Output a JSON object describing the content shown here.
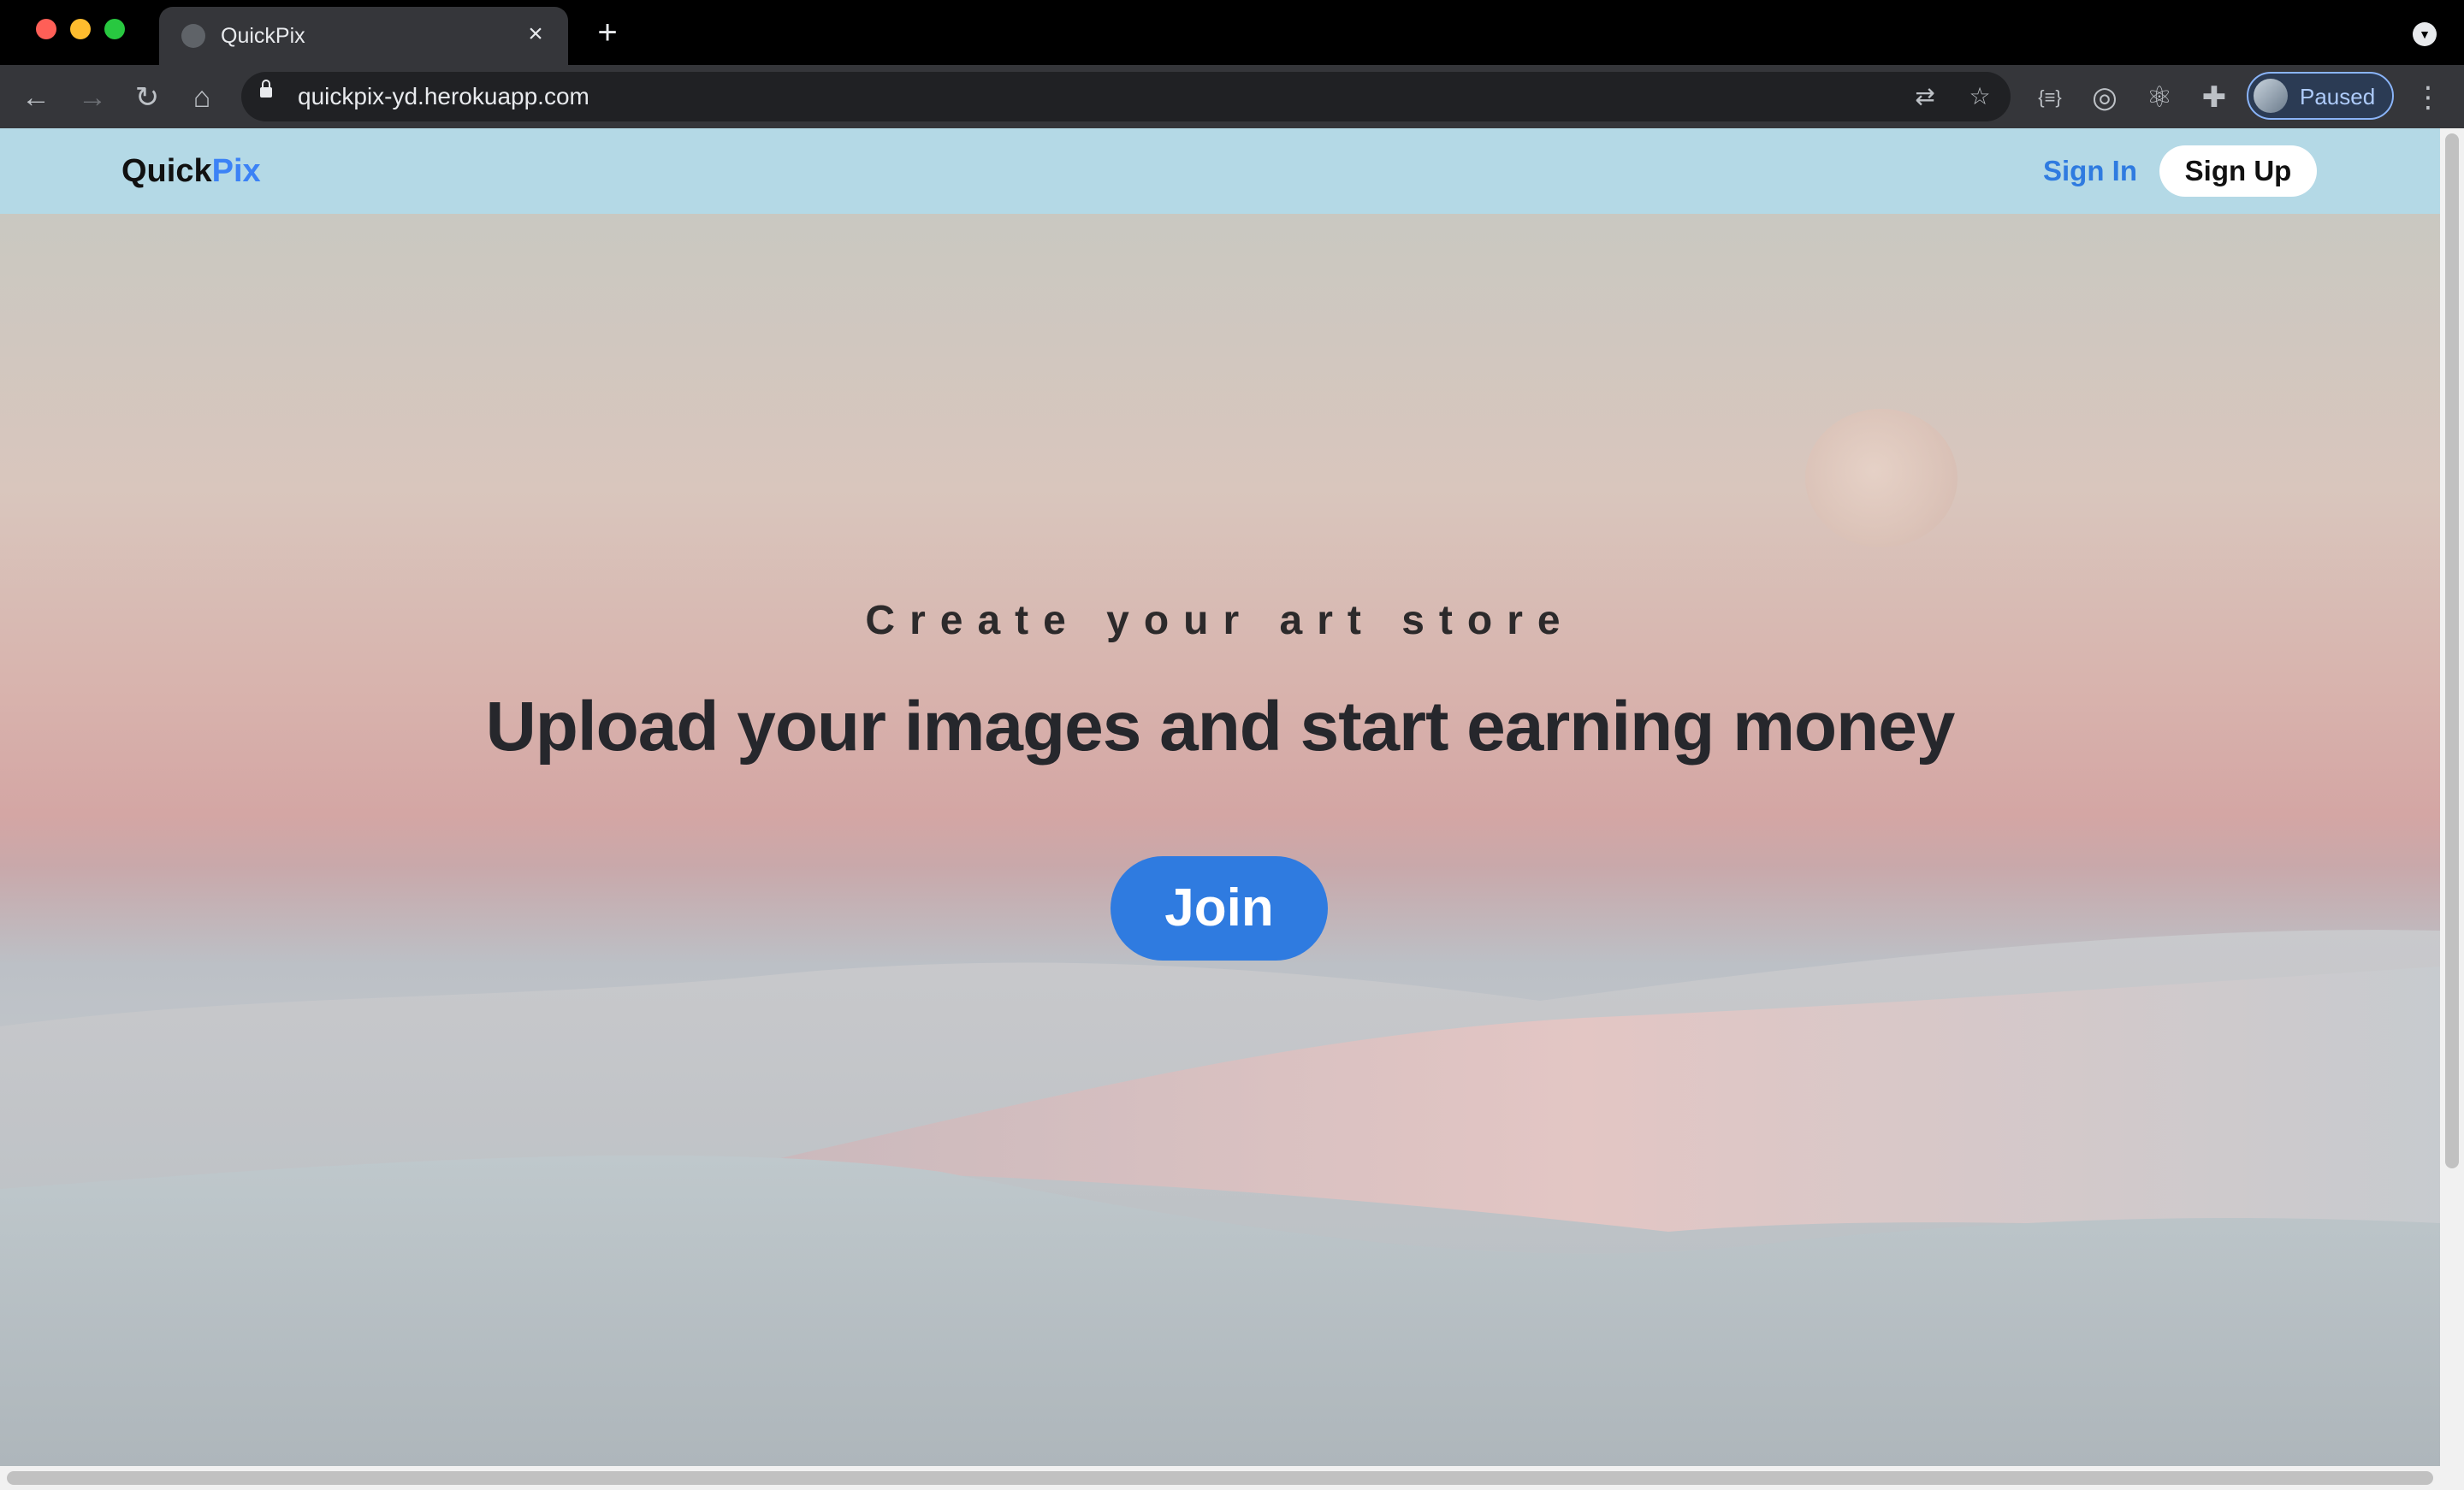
{
  "browser": {
    "tab_title": "QuickPix",
    "url": "quickpix-yd.herokuapp.com",
    "profile_status": "Paused",
    "icons": {
      "back": "back-arrow-icon",
      "forward": "forward-arrow-icon",
      "reload": "reload-icon",
      "home": "home-icon",
      "translate": "translate-icon",
      "bookmark": "star-icon",
      "extensions": "puzzle-icon"
    },
    "colors": {
      "tab_bar": "#000000",
      "toolbar": "#35363a",
      "omnibox": "#202124"
    }
  },
  "site": {
    "logo_part1": "Quick",
    "logo_part2": "Pix",
    "nav": {
      "sign_in": "Sign In",
      "sign_up": "Sign Up"
    },
    "hero": {
      "subtitle": "Create your art store",
      "headline": "Upload your images and start earning money",
      "cta": "Join"
    },
    "colors": {
      "navbar": "#b4d9e6",
      "accent": "#2f7be0",
      "text_dark": "#26272c"
    }
  }
}
